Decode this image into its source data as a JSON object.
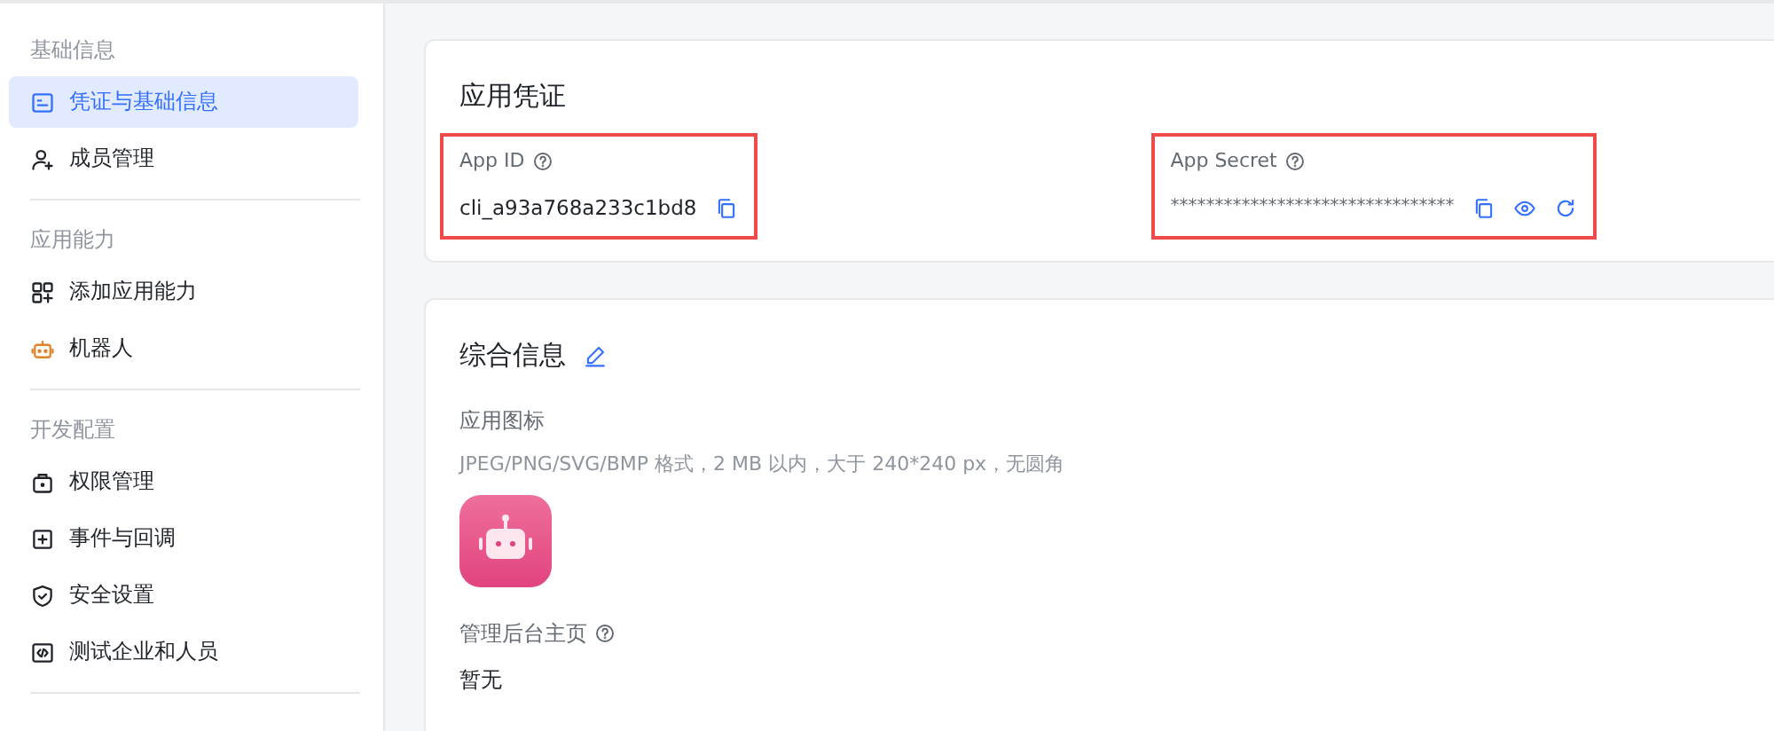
{
  "sidebar": {
    "groups": [
      {
        "label": "基础信息",
        "items": [
          {
            "label": "凭证与基础信息",
            "selected": true
          },
          {
            "label": "成员管理",
            "selected": false
          }
        ]
      },
      {
        "label": "应用能力",
        "items": [
          {
            "label": "添加应用能力",
            "selected": false
          },
          {
            "label": "机器人",
            "selected": false
          }
        ]
      },
      {
        "label": "开发配置",
        "items": [
          {
            "label": "权限管理",
            "selected": false
          },
          {
            "label": "事件与回调",
            "selected": false
          },
          {
            "label": "安全设置",
            "selected": false
          },
          {
            "label": "测试企业和人员",
            "selected": false
          }
        ]
      }
    ]
  },
  "credentials": {
    "title": "应用凭证",
    "fields": [
      {
        "label": "App ID",
        "value": "cli_a93a768a233c1bd8",
        "masked": false,
        "highlighted": true
      },
      {
        "label": "App Secret",
        "value": "********************************",
        "masked": true,
        "highlighted": true
      }
    ]
  },
  "info": {
    "title": "综合信息",
    "sections": [
      {
        "kind": "image",
        "label": "应用图标",
        "hint": "JPEG/PNG/SVG/BMP 格式，2 MB 以内，大于 240*240 px，无圆角"
      },
      {
        "kind": "text",
        "label": "管理后台主页",
        "value": "暂无"
      }
    ]
  }
}
